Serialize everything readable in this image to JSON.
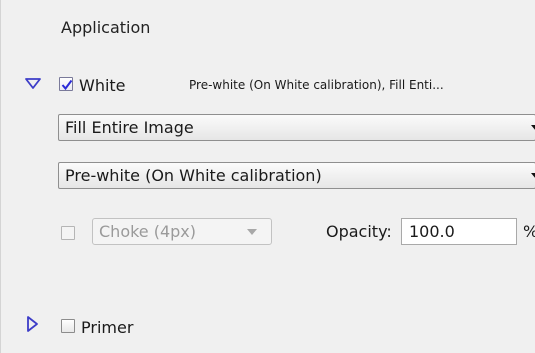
{
  "section": {
    "title": "Application"
  },
  "white": {
    "label": "White",
    "checked": true,
    "expanded": true,
    "summary": "Pre-white (On White calibration), Fill Enti...",
    "fill_select": {
      "value": "Fill Entire Image"
    },
    "calibration_select": {
      "value": "Pre-white (On White calibration)"
    },
    "choke": {
      "checked": false,
      "value": "Choke (4px)",
      "disabled": true
    },
    "opacity": {
      "label": "Opacity:",
      "value": "100.0",
      "unit": "%"
    }
  },
  "primer": {
    "label": "Primer",
    "checked": false,
    "expanded": false
  },
  "colors": {
    "disclosure": "#3d3dc8",
    "checkmark": "#2a2ad8"
  },
  "icons": {
    "white_toggle": "triangle-down-icon",
    "primer_toggle": "triangle-right-icon",
    "check": "checkmark-icon",
    "dropdown": "chevron-down-icon"
  }
}
